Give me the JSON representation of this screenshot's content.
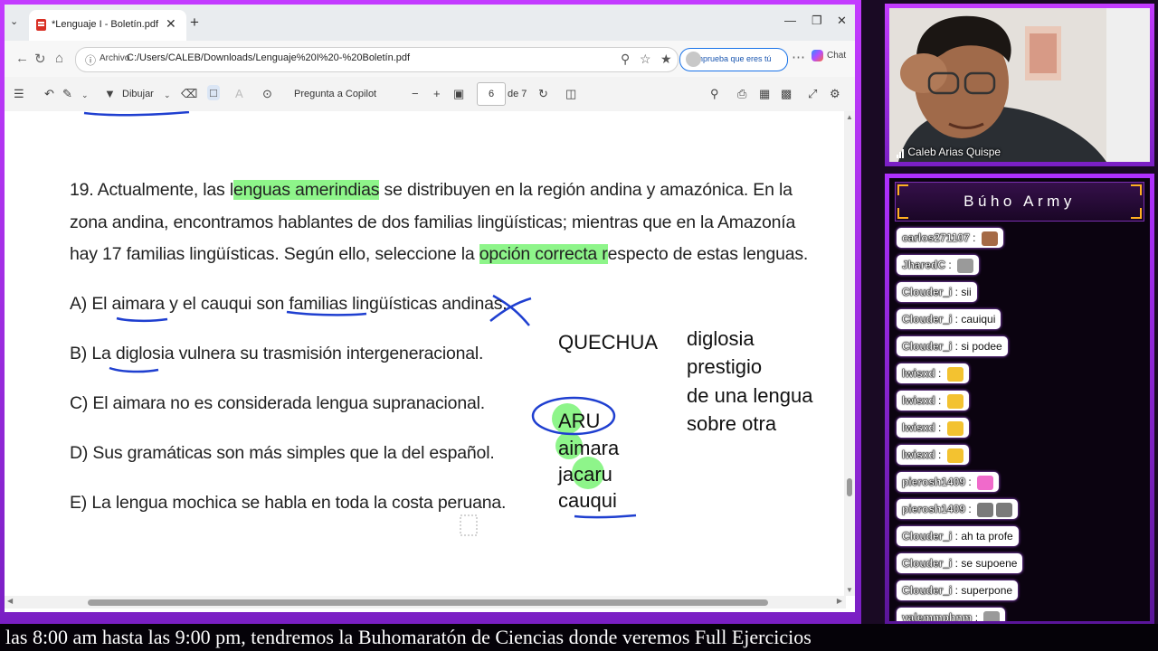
{
  "browser": {
    "tab_title": "*Lenguaje I - Boletín.pdf",
    "address_label": "Archivo",
    "url": "C:/Users/CALEB/Downloads/Lenguaje%20I%20-%20Boletín.pdf",
    "verify_label": "Comprueba que eres tú",
    "chat_label": "Chat"
  },
  "pdf_toolbar": {
    "draw_label": "Dibujar",
    "copilot_label": "Pregunta a Copilot",
    "page_current": "6",
    "page_total": "de 7"
  },
  "question": {
    "line1_pre": "19. Actualmente, las l",
    "line1_hl": "enguas amerindias",
    "line1_post": " se distribuyen en la región andina y amazónica. En la",
    "line2": "zona andina, encontramos hablantes de dos familias lingüísticas; mientras que en la Amazonía",
    "line3_pre": "hay 17 familias lingüísticas. Según ello, seleccione la ",
    "line3_hl": "opción correcta r",
    "line3_post": "especto de estas lenguas.",
    "options": [
      "A) El aimara y el cauqui son familias lingüísticas andinas.",
      "B) La diglosia vulnera su trasmisión intergeneracional.",
      "C) El aimara no es considerada lengua supranacional.",
      "D) Sus gramáticas son más simples que la del español.",
      "E) La lengua mochica se habla en toda la costa peruana."
    ]
  },
  "annotations": {
    "quechua": "QUECHUA",
    "aru_list": [
      "ARU",
      "aimara",
      "jacaru",
      "cauqui"
    ],
    "diglosia_lines": [
      "diglosia",
      "prestigio",
      "de una lengua",
      "sobre otra"
    ]
  },
  "webcam": {
    "name": "Caleb Arias Quispe"
  },
  "chat": {
    "title": "Búho Army",
    "messages": [
      {
        "user": "carlos271107",
        "text": "",
        "emote": "face"
      },
      {
        "user": "JharedC",
        "text": "",
        "emote": "cat"
      },
      {
        "user": "Clouder_i",
        "text": "sii",
        "emote": ""
      },
      {
        "user": "Clouder_i",
        "text": "cauiqui",
        "emote": ""
      },
      {
        "user": "Clouder_i",
        "text": "si podee",
        "emote": ""
      },
      {
        "user": "lwisxd",
        "text": "",
        "emote": "yellow"
      },
      {
        "user": "lwisxd",
        "text": "",
        "emote": "yellow"
      },
      {
        "user": "lwisxd",
        "text": "",
        "emote": "yellow"
      },
      {
        "user": "lwisxd",
        "text": "",
        "emote": "yellow"
      },
      {
        "user": "pierosh1409",
        "text": "",
        "emote": "pink"
      },
      {
        "user": "pierosh1409",
        "text": "",
        "emote": "cat2"
      },
      {
        "user": "Clouder_i",
        "text": "ah ta profe",
        "emote": ""
      },
      {
        "user": "Clouder_i",
        "text": "se supoene",
        "emote": ""
      },
      {
        "user": "Clouder_i",
        "text": "superpone",
        "emote": ""
      },
      {
        "user": "valemmphnm",
        "text": "",
        "emote": "cat"
      }
    ]
  },
  "ticker": {
    "text": "las 8:00 am hasta las 9:00 pm, tendremos la Buhomaratón de Ciencias donde veremos Full Ejercicios"
  },
  "colors": {
    "frame_purple": "#c33bff",
    "highlight_green": "#8ef58a",
    "ink_blue": "#1f3fd0"
  }
}
